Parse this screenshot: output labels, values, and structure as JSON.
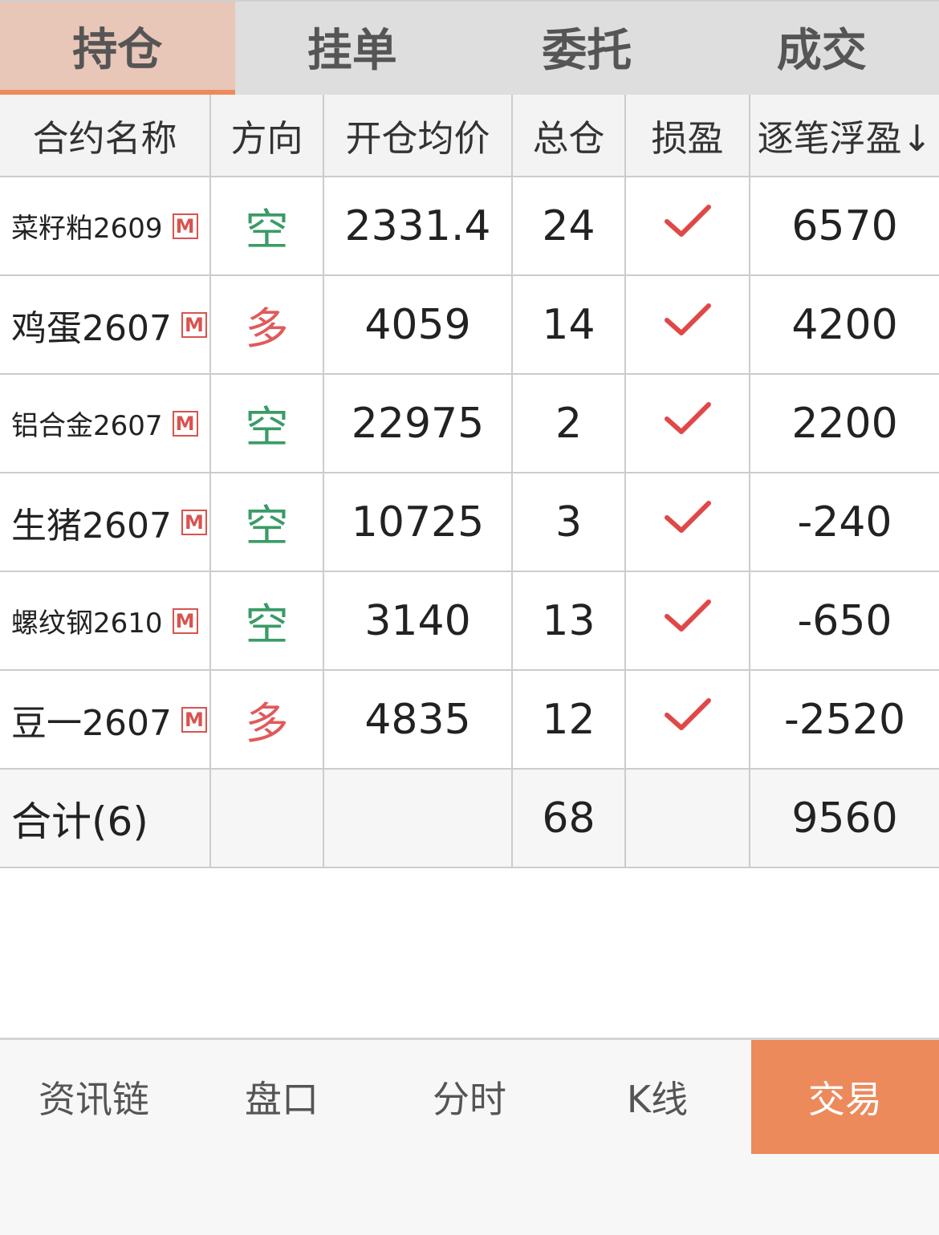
{
  "tabs": [
    {
      "label": "持仓",
      "active": true
    },
    {
      "label": "挂单",
      "active": false
    },
    {
      "label": "委托",
      "active": false
    },
    {
      "label": "成交",
      "active": false
    }
  ],
  "columns": [
    "合约名称",
    "方向",
    "开仓均价",
    "总仓",
    "损盈",
    "逐笔浮盈↓"
  ],
  "rows": [
    {
      "name": "菜籽粕2609",
      "badge": "M",
      "direction": "空",
      "avg_price": "2331.4",
      "total": "24",
      "profit": "6570"
    },
    {
      "name": "鸡蛋2607",
      "badge": "M",
      "direction": "多",
      "avg_price": "4059",
      "total": "14",
      "profit": "4200"
    },
    {
      "name": "铝合金2607",
      "badge": "M",
      "direction": "空",
      "avg_price": "22975",
      "total": "2",
      "profit": "2200"
    },
    {
      "name": "生猪2607",
      "badge": "M",
      "direction": "空",
      "avg_price": "10725",
      "total": "3",
      "profit": "-240"
    },
    {
      "name": "螺纹钢2610",
      "badge": "M",
      "direction": "空",
      "avg_price": "3140",
      "total": "13",
      "profit": "-650"
    },
    {
      "name": "豆一2607",
      "badge": "M",
      "direction": "多",
      "avg_price": "4835",
      "total": "12",
      "profit": "-2520"
    }
  ],
  "summary": {
    "label": "合计(6)",
    "total": "68",
    "profit": "9560"
  },
  "bottom_nav": [
    {
      "label": "资讯链",
      "active": false
    },
    {
      "label": "盘口",
      "active": false
    },
    {
      "label": "分时",
      "active": false
    },
    {
      "label": "K线",
      "active": false
    },
    {
      "label": "交易",
      "active": true
    }
  ],
  "colors": {
    "accent": "#ec8a5c",
    "active_tab_bg": "#e8c6b8",
    "profit": "#d95b5b",
    "loss": "#3a9b67",
    "check": "#e04848"
  },
  "icons": {
    "stop_profit_set": "check-icon",
    "market_badge": "m-badge-icon"
  }
}
